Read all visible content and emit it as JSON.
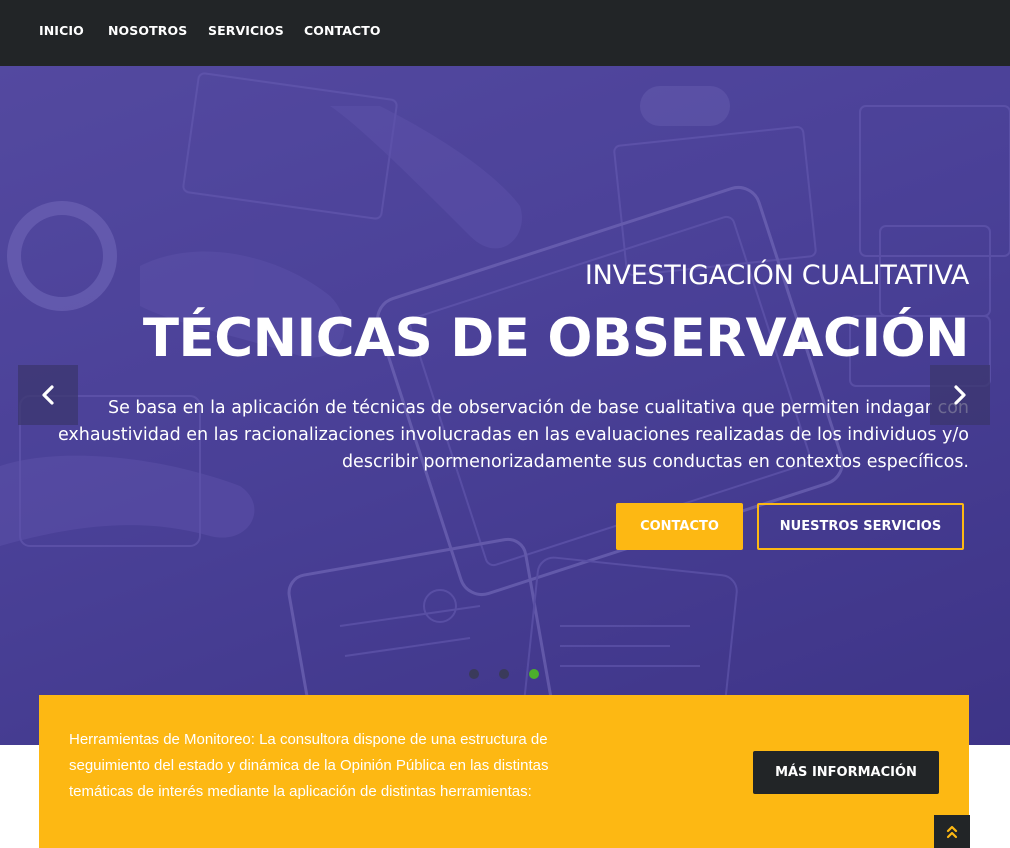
{
  "nav": {
    "items": [
      {
        "label": "INICIO"
      },
      {
        "label": "NOSOTROS"
      },
      {
        "label": "SERVICIOS"
      },
      {
        "label": "CONTACTO"
      }
    ]
  },
  "hero": {
    "subtitle": "INVESTIGACIÓN CUALITATIVA",
    "title": "TÉCNICAS DE OBSERVACIÓN",
    "description": "Se basa en la aplicación de técnicas de observación de base cualitativa que permiten indagar con exhaustividad en las racionalizaciones involucradas en las evaluaciones realizadas de los individuos y/o describir pormenorizadamente sus conductas en contextos específicos.",
    "contact_button": "CONTACTO",
    "services_button": "NUESTROS SERVICIOS",
    "prev_icon": "chevron-left-icon",
    "next_icon": "chevron-right-icon",
    "slides_total": 3,
    "active_slide": 3
  },
  "info": {
    "text": "Herramientas de Monitoreo: La consultora dispone de una estructura de seguimiento del estado y dinámica de la Opinión Pública en las distintas temáticas de interés mediante la aplicación de distintas herramientas:",
    "button": "MÁS INFORMACIÓN"
  },
  "scroll_top_icon": "double-chevron-up-icon",
  "colors": {
    "nav_bg": "#222527",
    "accent": "#fdb813",
    "hero_overlay": "#4f4899",
    "dot_active": "#4caf2a",
    "dot_inactive": "#3a3a5a"
  }
}
